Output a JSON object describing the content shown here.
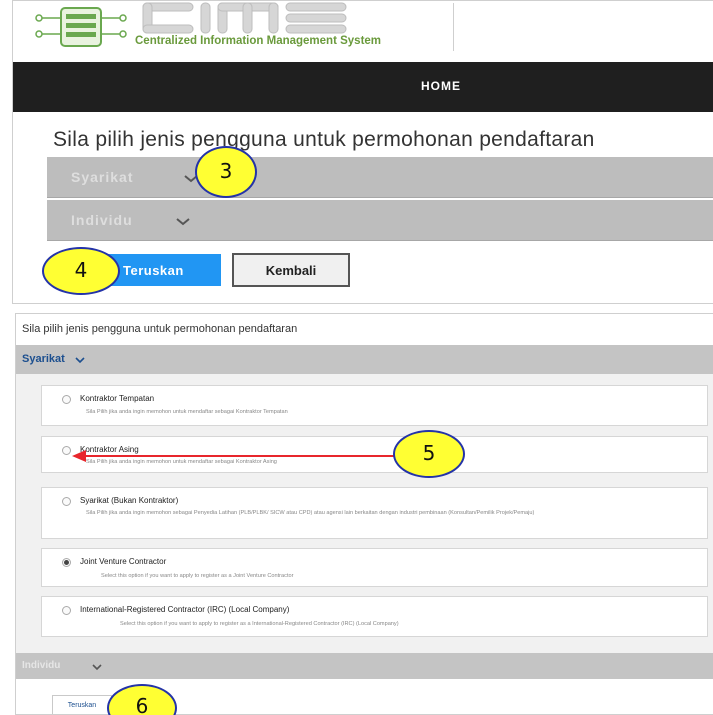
{
  "header": {
    "brand_subtitle": "Centralized Information Management System",
    "logo_name": "cims-logo",
    "logo_wordmark": "CIMS",
    "nav_home": "HOME"
  },
  "panel_main": {
    "title": "Sila pilih jenis pengguna untuk permohonan pendaftaran",
    "sections": [
      {
        "label": "Syarikat"
      },
      {
        "label": "Individu"
      }
    ],
    "buttons": {
      "teruskan": "Teruskan",
      "kembali": "Kembali"
    }
  },
  "panel_detail": {
    "title": "Sila pilih jenis pengguna untuk permohonan pendaftaran",
    "syarikat_label": "Syarikat",
    "individu_label": "Individu",
    "options": [
      {
        "title": "Kontraktor Tempatan",
        "description": "Sila Pilih jika anda ingin memohon untuk mendaftar sebagai Kontraktor Tempatan",
        "selected": false
      },
      {
        "title": "Kontraktor Asing",
        "description": "Sila Pilih jika anda ingin memohon untuk mendaftar sebagai Kontraktor Asing",
        "selected": false
      },
      {
        "title": "Syarikat (Bukan Kontraktor)",
        "description": "Sila Pilih jika anda ingin memohon sebagai Penyedia Latihan (PLB/PLBK/ SICW atau CPD) atau agensi lain berkaitan dengan industri pembinaan (Konsultan/Pemilik Projek/Pemaju)",
        "selected": false
      },
      {
        "title": "Joint Venture Contractor",
        "description": "Select this option if you want to apply to register as a Joint Venture Contractor",
        "selected": true
      },
      {
        "title": "International-Registered Contractor (IRC) (Local Company)",
        "description": "Select this option if you want to apply to register as a International-Registered Contractor (IRC) (Local Company)",
        "selected": false
      }
    ],
    "continue_button": "Teruskan"
  },
  "annotations": {
    "step3": "3",
    "step4": "4",
    "step5": "5",
    "step6": "6",
    "colors": {
      "callout_fill": "#ffff33",
      "callout_border": "#2433a8",
      "arrow": "#e8262c"
    }
  },
  "colors": {
    "navbar": "#1f1f1f",
    "primary_button": "#2196f3",
    "section_band": "#bdbdbd",
    "link_blue": "#1c4f8f"
  }
}
